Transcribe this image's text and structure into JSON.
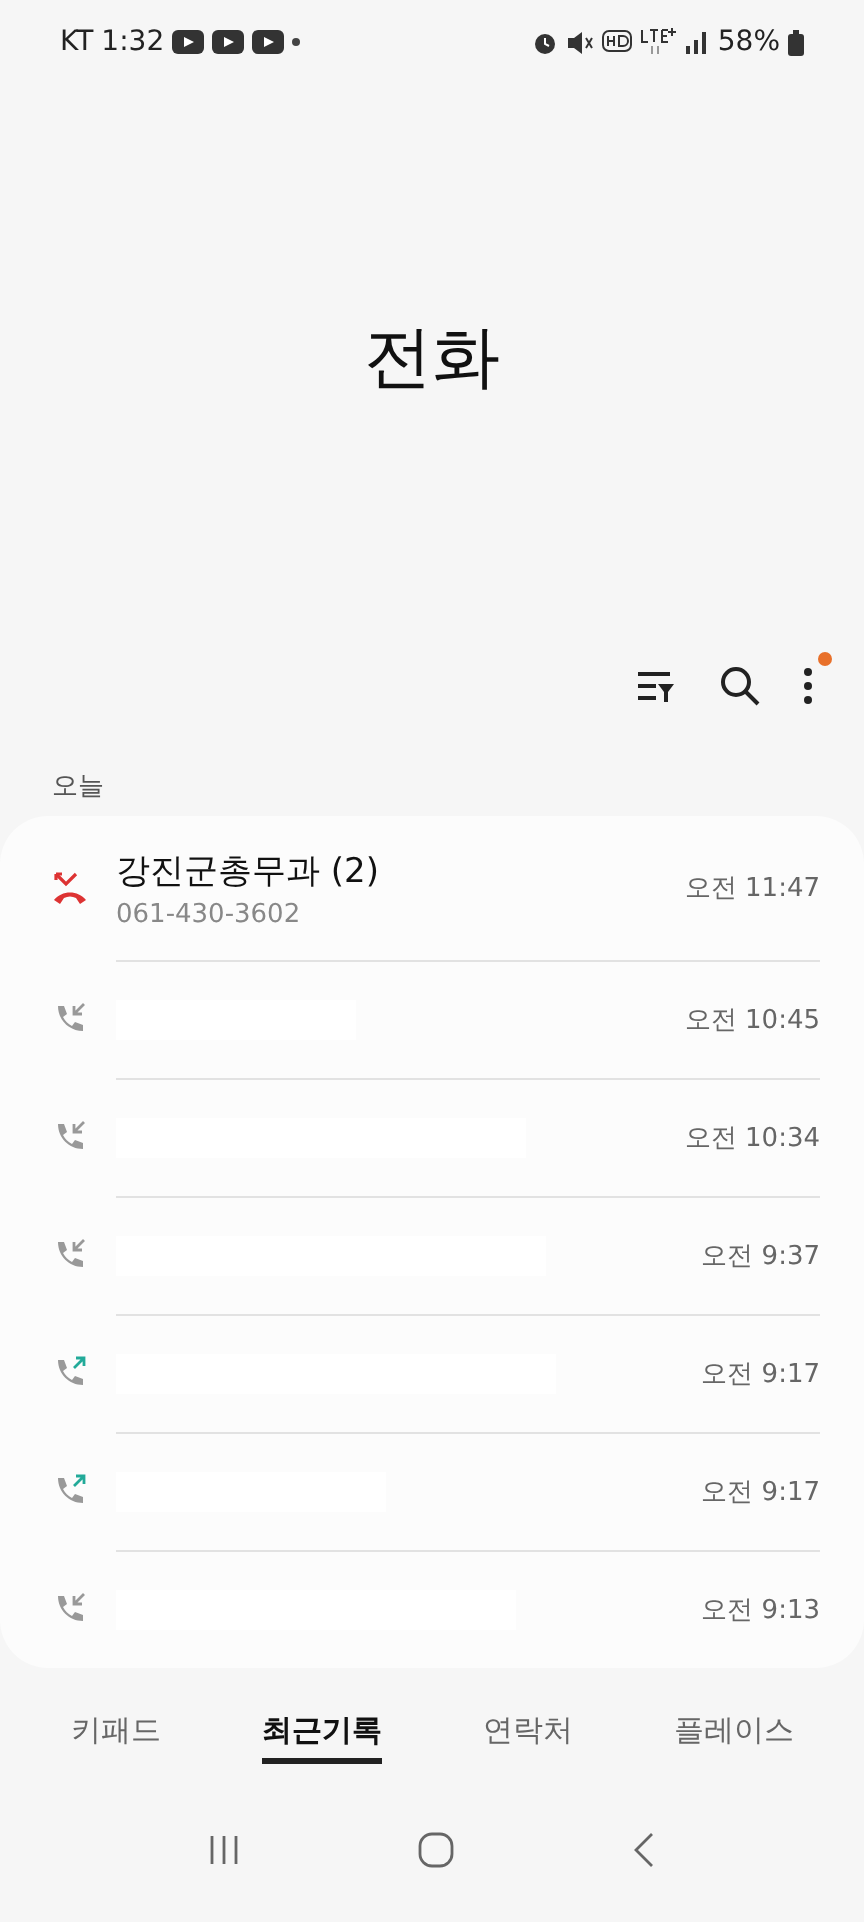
{
  "status_bar": {
    "carrier": "KT",
    "time": "1:32",
    "battery": "58%"
  },
  "title": "전화",
  "section": "오늘",
  "calls": [
    {
      "kind": "missed",
      "name": "강진군총무과 (2)",
      "number": "061-430-3602",
      "time": "오전 11:47"
    },
    {
      "kind": "incoming",
      "time": "오전 10:45"
    },
    {
      "kind": "incoming",
      "time": "오전 10:34"
    },
    {
      "kind": "incoming",
      "time": "오전 9:37"
    },
    {
      "kind": "outgoing",
      "time": "오전 9:17"
    },
    {
      "kind": "outgoing",
      "time": "오전 9:17"
    },
    {
      "kind": "incoming",
      "time": "오전 9:13"
    }
  ],
  "tabs": [
    {
      "label": "키패드",
      "selected": false
    },
    {
      "label": "최근기록",
      "selected": true
    },
    {
      "label": "연락처",
      "selected": false
    },
    {
      "label": "플레이스",
      "selected": false
    }
  ]
}
